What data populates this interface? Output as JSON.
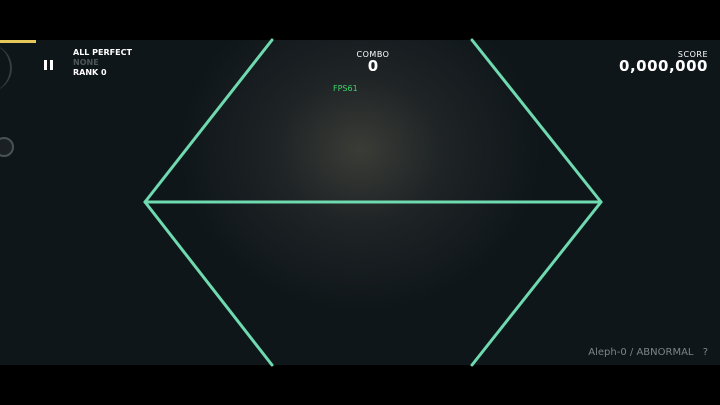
{
  "hud": {
    "status_line1": "ALL PERFECT",
    "status_line2": "NONE",
    "status_line3": "RANK 0",
    "combo_label": "COMBO",
    "combo_value": "0",
    "fps": "FPS61",
    "score_label": "SCORE",
    "score_value": "0,000,000",
    "pause_icon": "pause-icon"
  },
  "song": {
    "title": "Aleph-0",
    "separator": "/",
    "difficulty": "ABNORMAL",
    "help": "?"
  },
  "progress": {
    "fraction": 0.05
  },
  "colors": {
    "line": "#6fd9b0",
    "progress": "#e6c85a",
    "fps": "#3fd56b",
    "background": "#0f1619"
  }
}
